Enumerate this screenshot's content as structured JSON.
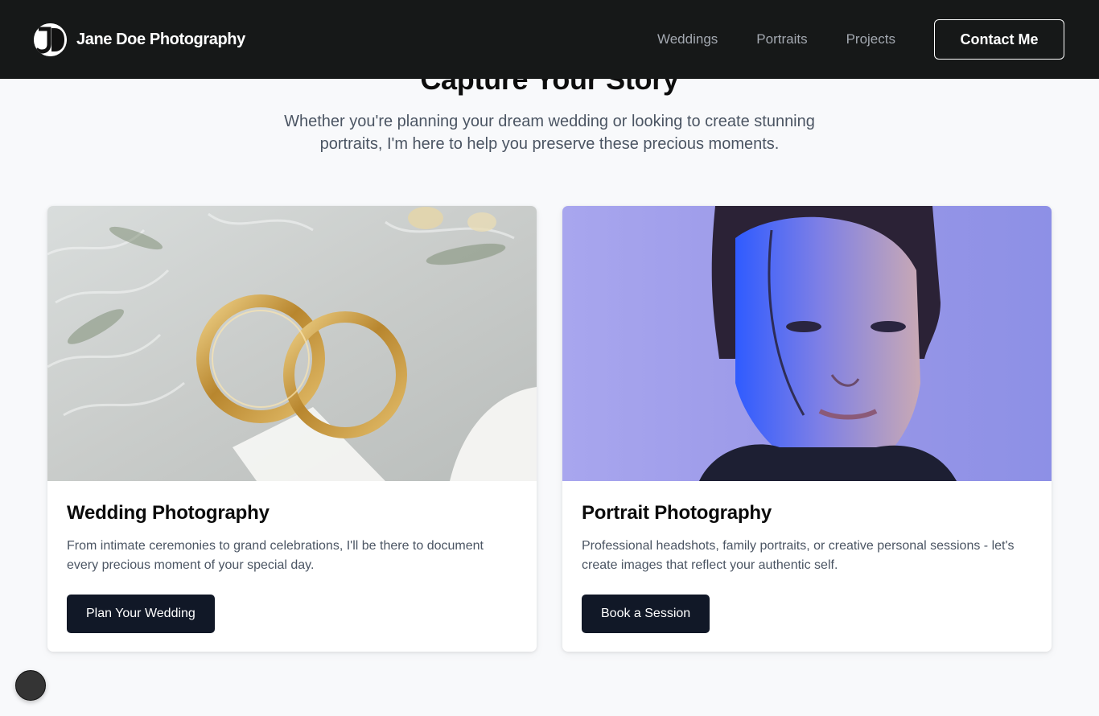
{
  "header": {
    "logo_text": "JD",
    "brand_name": "Jane Doe Photography",
    "nav": [
      "Weddings",
      "Portraits",
      "Projects"
    ],
    "cta_label": "Contact Me"
  },
  "hero": {
    "title": "Capture Your Story",
    "subtitle": "Whether you're planning your dream wedding or looking to create stunning portraits, I'm here to help you preserve these precious moments."
  },
  "cards": [
    {
      "title": "Wedding Photography",
      "text": "From intimate ceremonies to grand celebrations, I'll be there to document every precious moment of your special day.",
      "button": "Plan Your Wedding",
      "image": "wedding-rings-photo"
    },
    {
      "title": "Portrait Photography",
      "text": "Professional headshots, family portraits, or creative personal sessions - let's create images that reflect your authentic self.",
      "button": "Book a Session",
      "image": "portrait-woman-photo"
    }
  ],
  "colors": {
    "header_bg": "#161818",
    "page_bg": "#f8f9fb",
    "button_bg": "#111827",
    "muted_text": "#4b5563"
  }
}
